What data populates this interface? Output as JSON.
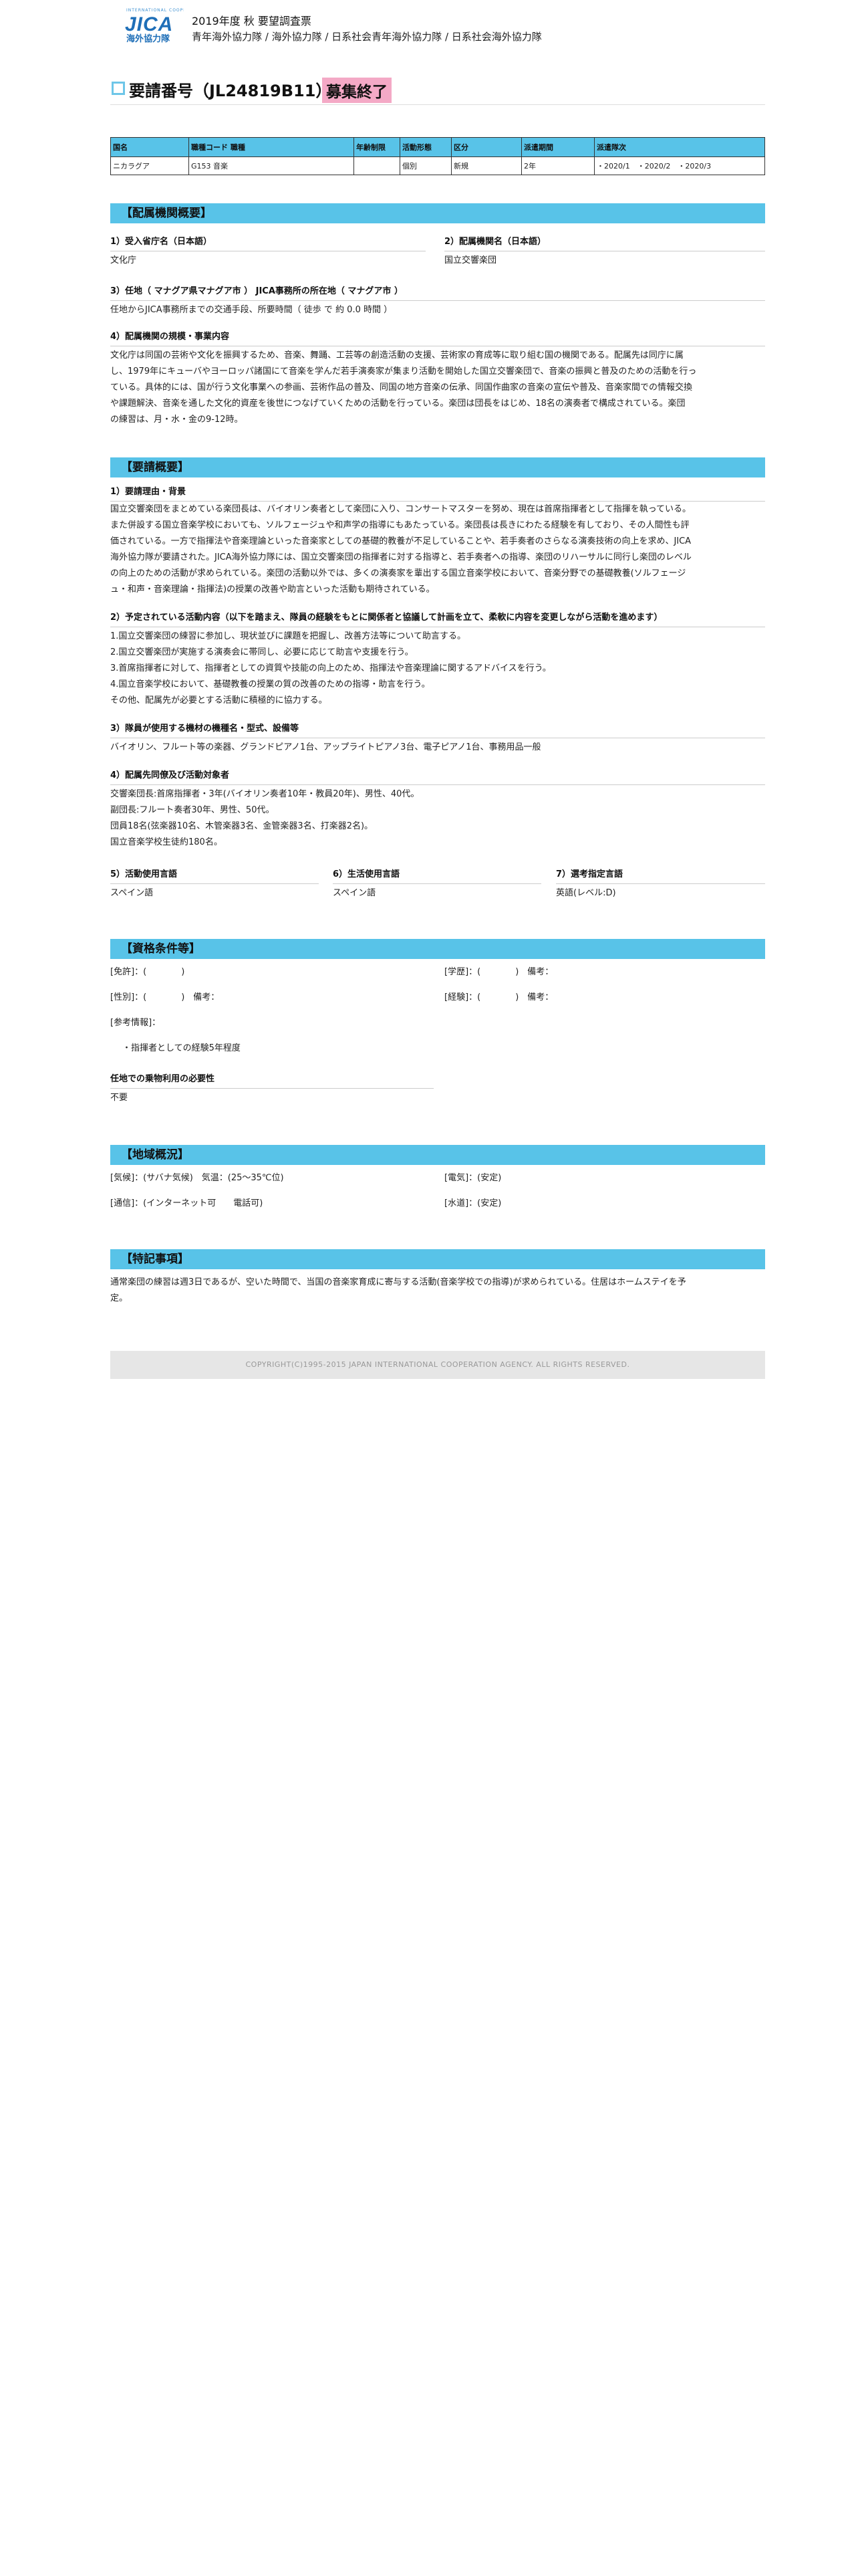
{
  "header": {
    "logo_tagline": "INTERNATIONAL COOPERATION",
    "logo_main": "JICA",
    "logo_sub": "海外協力隊",
    "line1": "2019年度 秋 要望調査票",
    "line2": "青年海外協力隊 / 海外協力隊 / 日系社会青年海外協力隊 / 日系社会海外協力隊"
  },
  "title": {
    "text": "要請番号（JL24819B11）",
    "status": "募集終了"
  },
  "summary_table": {
    "headers": [
      "国名",
      "職種コード 職種",
      "年齢制限",
      "活動形態",
      "区分",
      "派遣期間",
      "派遣隊次"
    ],
    "row": [
      "ニカラグア",
      "G153 音楽",
      "",
      "個別",
      "新規",
      "2年",
      "・2020/1　・2020/2　・2020/3"
    ]
  },
  "org": {
    "section_title": "【配属機関概要】",
    "ministry_label": "1）受入省庁名（日本語）",
    "ministry_value": "文化庁",
    "org_label": "2）配属機関名（日本語）",
    "org_value": "国立交響楽団",
    "location_label": "3）任地（ マナグア県マナグア市 ） JICA事務所の所在地（ マナグア市 ）",
    "location_value": "任地からJICA事務所までの交通手段、所要時間（ 徒歩 で 約 0.0 時間 ）",
    "scale_label": "4）配属機関の規模・事業内容",
    "scale_lines": [
      "文化庁は同国の芸術や文化を振興するため、音楽、舞踊、工芸等の創造活動の支援、芸術家の育成等に取り組む国の機関である。配属先は同庁に属",
      "し、1979年にキューバやヨーロッパ諸国にて音楽を学んだ若手演奏家が集まり活動を開始した国立交響楽団で、音楽の振興と普及のための活動を行っ",
      "ている。具体的には、国が行う文化事業への参画、芸術作品の普及、同国の地方音楽の伝承、同国作曲家の音楽の宣伝や普及、音楽家間での情報交換",
      "や課題解決、音楽を通した文化的資産を後世につなげていくための活動を行っている。楽団は団長をはじめ、18名の演奏者で構成されている。楽団",
      "の練習は、月・水・金の9-12時。"
    ]
  },
  "request": {
    "section_title": "【要請概要】",
    "reason_label": "1）要請理由・背景",
    "reason_lines": [
      "国立交響楽団をまとめている楽団長は、バイオリン奏者として楽団に入り、コンサートマスターを努め、現在は首席指揮者として指揮を執っている。",
      "また併設する国立音楽学校においても、ソルフェージュや和声学の指導にもあたっている。楽団長は長きにわたる経験を有しており、その人間性も評",
      "価されている。一方で指揮法や音楽理論といった音楽家としての基礎的教養が不足していることや、若手奏者のさらなる演奏技術の向上を求め、JICA",
      "海外協力隊が要請された。JICA海外協力隊には、国立交響楽団の指揮者に対する指導と、若手奏者への指導、楽団のリハーサルに同行し楽団のレベル",
      "の向上のための活動が求められている。楽団の活動以外では、多くの演奏家を輩出する国立音楽学校において、音楽分野での基礎教養(ソルフェージ",
      "ュ・和声・音楽理論・指揮法)の授業の改善や助言といった活動も期待されている。"
    ],
    "planned_label": "2）予定されている活動内容（以下を踏まえ、隊員の経験をもとに関係者と協議して計画を立て、柔軟に内容を変更しながら活動を進めます）",
    "planned_lines": [
      "1.国立交響楽団の練習に参加し、現状並びに課題を把握し、改善方法等について助言する。",
      "2.国立交響楽団が実施する演奏会に帯同し、必要に応じて助言や支援を行う。",
      "3.首席指揮者に対して、指揮者としての資質や技能の向上のため、指揮法や音楽理論に関するアドバイスを行う。",
      "4.国立音楽学校において、基礎教養の授業の質の改善のための指導・助言を行う。",
      "その他、配属先が必要とする活動に積極的に協力する。"
    ],
    "equipment_label": "3）隊員が使用する機材の機種名・型式、設備等",
    "equipment_value": "バイオリン、フルート等の楽器、グランドピアノ1台、アップライトピアノ3台、電子ピアノ1台、事務用品一般",
    "target_label": "4）配属先同僚及び活動対象者",
    "target_lines": [
      "交響楽団長:首席指揮者・3年(バイオリン奏者10年・教員20年)、男性、40代。",
      "副団長:フルート奏者30年、男性、50代。",
      "団員18名(弦楽器10名、木管楽器3名、金管楽器3名、打楽器2名)。",
      "国立音楽学校生徒約180名。"
    ],
    "lang1_label": "5）活動使用言語",
    "lang1_value": "スペイン語",
    "lang2_label": "6）生活使用言語",
    "lang2_value": "スペイン語",
    "lang3_label": "7）選考指定言語",
    "lang3_value": "英語(レベル:D)"
  },
  "qual": {
    "section_title": "【資格条件等】",
    "license": "[免許]：(　　　　)",
    "education": "[学歴]：(　　　　)　備考：",
    "gender": "[性別]：(　　　　)　備考：",
    "experience": "[経験]：(　　　　)　備考：",
    "reference_label": "[参考情報]：",
    "reference_item": "・指揮者としての経験5年程度",
    "vehicle_label": "任地での乗物利用の必要性",
    "vehicle_value": "不要"
  },
  "region": {
    "section_title": "【地域概況】",
    "climate": "[気候]：(サバナ気候)　気温：(25〜35℃位)",
    "electricity": "[電気]：(安定)",
    "communication": "[通信]：(インターネット可　　電話可)",
    "water": "[水道]：(安定)"
  },
  "notes": {
    "section_title": "【特記事項】",
    "lines": [
      "通常楽団の練習は週3日であるが、空いた時間で、当国の音楽家育成に寄与する活動(音楽学校での指導)が求められている。住居はホームステイを予",
      "定。"
    ]
  },
  "footer": {
    "copyright": "COPYRIGHT(C)1995-2015 JAPAN INTERNATIONAL COOPERATION AGENCY. ALL RIGHTS RESERVED."
  },
  "colors": {
    "section_bg": "#58c3e8",
    "badge_bg": "#f4a9c6",
    "logo_blue": "#1f6fb8"
  }
}
